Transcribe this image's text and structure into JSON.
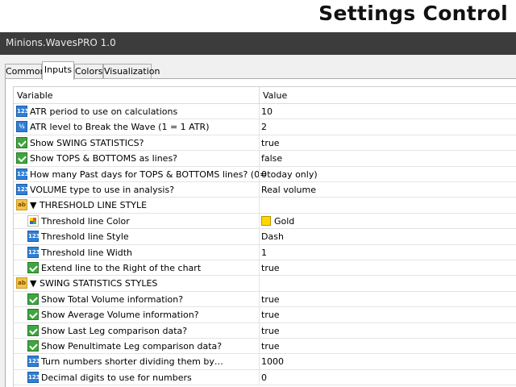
{
  "banner": {
    "title": "Settings Control"
  },
  "window": {
    "title": "Minions.WavesPRO 1.0"
  },
  "tabs": [
    {
      "label": "Common"
    },
    {
      "label": "Inputs"
    },
    {
      "label": "Colors"
    },
    {
      "label": "Visualization"
    }
  ],
  "active_tab": "Inputs",
  "table": {
    "col_variable": "Variable",
    "col_value": "Value"
  },
  "rows": [
    {
      "icon": "123",
      "label": "ATR period to use on calculations",
      "value": "10"
    },
    {
      "icon": "1/2",
      "label": "ATR level to Break the Wave (1 = 1 ATR)",
      "value": "2"
    },
    {
      "icon": "bool",
      "label": "Show SWING STATISTICS?",
      "value": "true"
    },
    {
      "icon": "bool",
      "label": "Show TOPS & BOTTOMS as lines?",
      "value": "false"
    },
    {
      "icon": "123",
      "label": "How many Past days for TOPS & BOTTOMS lines? (0=today only)",
      "value": "0"
    },
    {
      "icon": "123",
      "label": "VOLUME type to use in analysis?",
      "value": "Real volume"
    },
    {
      "icon": "ab",
      "label": "▼ THRESHOLD LINE STYLE",
      "value": ""
    },
    {
      "icon": "color",
      "label": "Threshold line Color",
      "value": "Gold"
    },
    {
      "icon": "123",
      "label": "Threshold line Style",
      "value": "Dash"
    },
    {
      "icon": "123",
      "label": "Threshold line Width",
      "value": "1"
    },
    {
      "icon": "bool",
      "label": "Extend line to the Right of the chart",
      "value": "true"
    },
    {
      "icon": "ab",
      "label": "▼ SWING STATISTICS STYLES",
      "value": ""
    },
    {
      "icon": "bool",
      "label": "Show Total Volume information?",
      "value": "true"
    },
    {
      "icon": "bool",
      "label": "Show Average Volume information?",
      "value": "true"
    },
    {
      "icon": "bool",
      "label": "Show Last Leg comparison data?",
      "value": "true"
    },
    {
      "icon": "bool",
      "label": "Show Penultimate Leg comparison data?",
      "value": "true"
    },
    {
      "icon": "123",
      "label": "Turn numbers shorter dividing them by…",
      "value": "1000"
    },
    {
      "icon": "123",
      "label": "Decimal digits to use for numbers",
      "value": "0"
    }
  ],
  "colors": {
    "gold": "#ffd700",
    "titlebar": "#3c3c3c"
  }
}
